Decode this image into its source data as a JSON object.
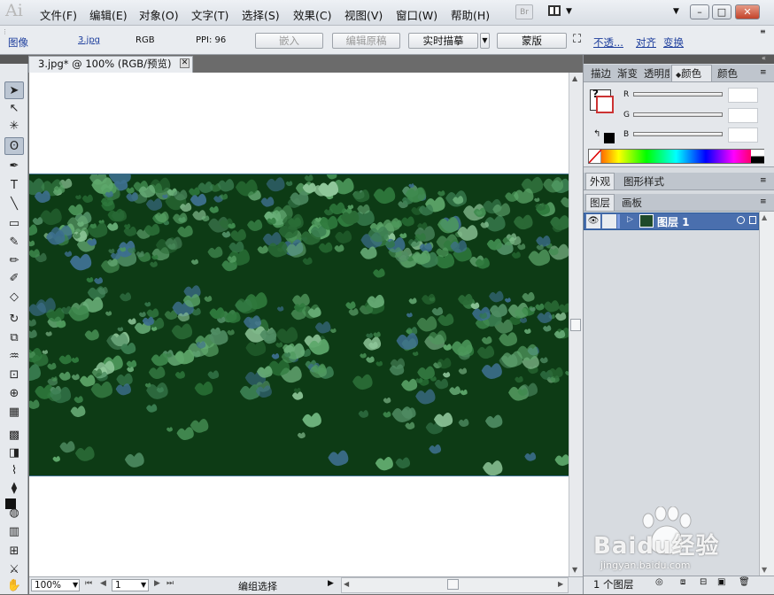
{
  "app": {
    "logo": "Ai",
    "bridge_button": "Br"
  },
  "menu": [
    "文件(F)",
    "编辑(E)",
    "对象(O)",
    "文字(T)",
    "选择(S)",
    "效果(C)",
    "视图(V)",
    "窗口(W)",
    "帮助(H)"
  ],
  "window_controls": {
    "minimize": "–",
    "restore": "□",
    "close": "✕"
  },
  "control_bar": {
    "object_type": "图像",
    "file_link": "3.jpg",
    "color_mode": "RGB",
    "ppi": "PPI: 96",
    "embed": "嵌入",
    "edit_original": "编辑原稿",
    "live_trace": "实时描摹",
    "mask": "蒙版",
    "opacity": "不透...",
    "align": "对齐",
    "transform": "变换"
  },
  "document": {
    "tab_title": "3.jpg* @ 100% (RGB/预览)",
    "tab_close": "✕"
  },
  "status_bar": {
    "zoom": "100%",
    "artboard": "1",
    "status": "编组选择"
  },
  "panels": {
    "color_tabs": [
      "描边",
      "渐变",
      "透明度",
      "颜色",
      "颜色"
    ],
    "color_channels": [
      "R",
      "G",
      "B"
    ],
    "appearance_tabs": [
      "外观",
      "图形样式"
    ],
    "layer_tabs": [
      "图层",
      "画板"
    ],
    "layer_name": "图层 1",
    "layer_count": "1 个图层"
  },
  "watermark": {
    "brand": "Baidu经验",
    "url": "jingyan.baidu.com"
  },
  "colors": {
    "image_base": "#0d3b15",
    "selection_blue": "#4a6fae",
    "accent_link": "#1c3d9c"
  }
}
